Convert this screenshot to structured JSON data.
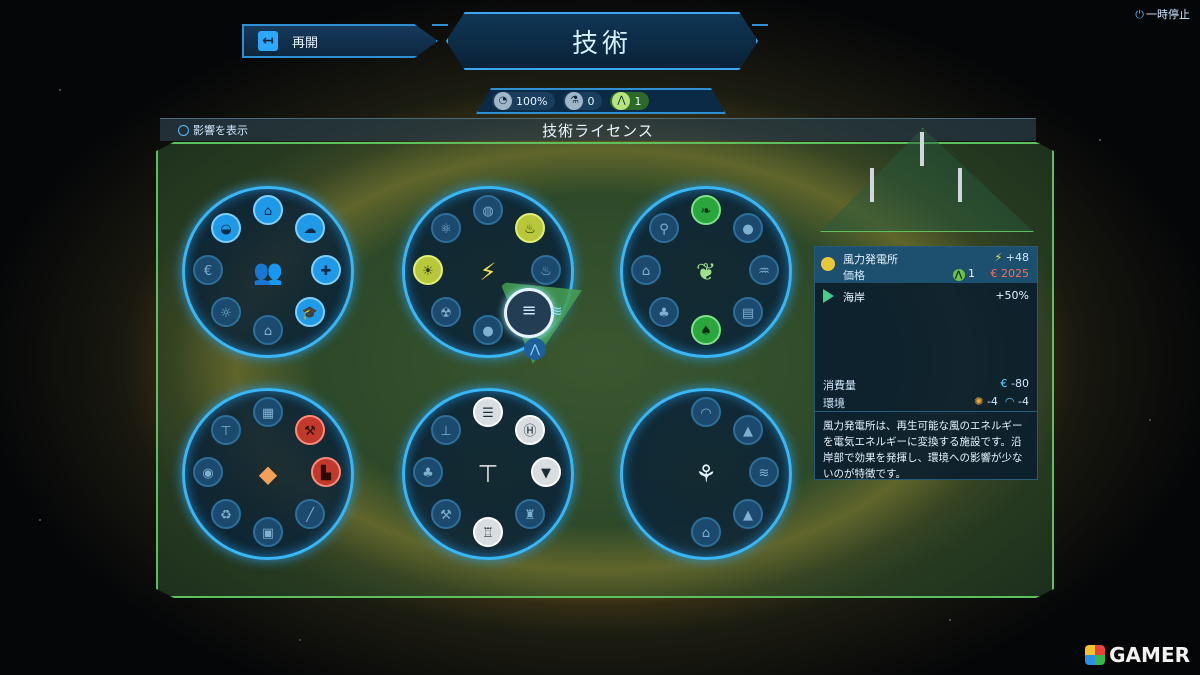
{
  "topbar": {
    "back_label": "再開",
    "title": "技術",
    "pause_label": "一時停止"
  },
  "resources": [
    {
      "name": "happiness",
      "value": "100%",
      "icon": "pie-icon"
    },
    {
      "name": "research",
      "value": "0",
      "icon": "flask-icon"
    },
    {
      "name": "license",
      "value": "1",
      "icon": "compass-icon",
      "active": true
    }
  ],
  "panel": {
    "show_effect_label": "影響を表示",
    "title": "技術ライセンス"
  },
  "wheels": [
    {
      "id": "social",
      "center_icon": "people-icon"
    },
    {
      "id": "energy",
      "center_icon": "lightning-icon"
    },
    {
      "id": "agriculture",
      "center_icon": "leaf-icon"
    },
    {
      "id": "industry",
      "center_icon": "crate-icon"
    },
    {
      "id": "construction",
      "center_icon": "screw-icon"
    },
    {
      "id": "advanced",
      "center_icon": "circuit-icon"
    }
  ],
  "info": {
    "building_name": "風力発電所",
    "power_output": "+48",
    "price_label": "価格",
    "license_cost": "1",
    "money_cost": "2025",
    "bonus_label": "海岸",
    "bonus_value": "+50%",
    "consumption_label": "消費量",
    "consumption_value": "-80",
    "environment_label": "環境",
    "environment_a": "-4",
    "environment_b": "-4",
    "description": "風力発電所は、再生可能な風のエネルギーを電気エネルギーに変換する施設です。沿岸部で効果を発揮し、環境への影響が少ないのが特徴です。",
    "euro_symbol": "€",
    "bolt_symbol": "⚡"
  },
  "watermark": "GAMER",
  "colors": {
    "accent": "#38b6f5",
    "board": "#5dbf5d",
    "cost": "#ff6a5a"
  }
}
